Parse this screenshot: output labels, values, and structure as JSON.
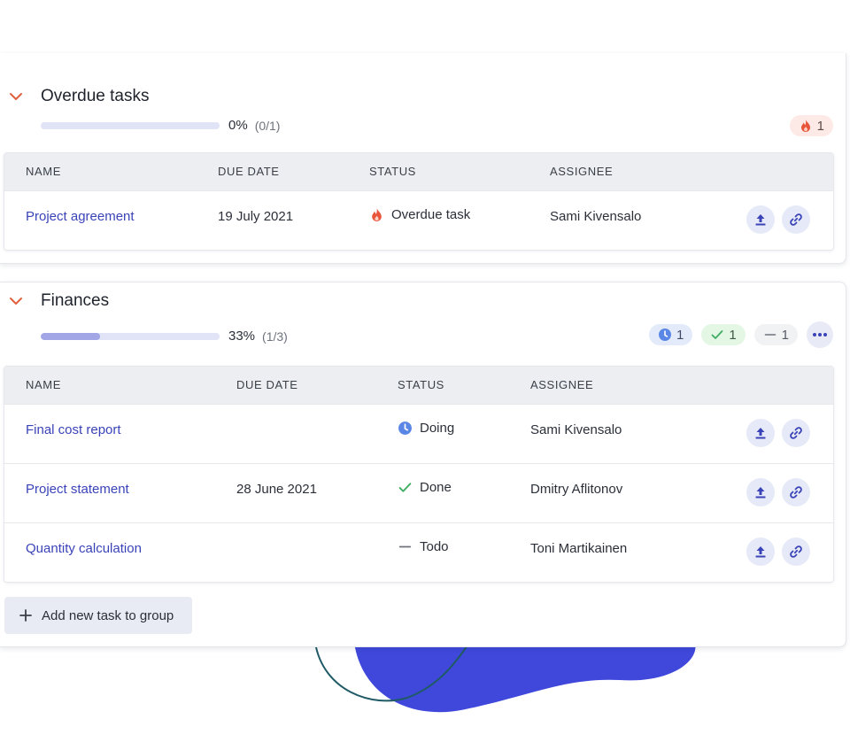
{
  "colors": {
    "accent_link": "#3a43b7",
    "chevron_orange": "#e0603e",
    "blob_blue": "#3f48db",
    "progress_track": "#e1e3f6",
    "progress_fill": "#a2a6e6"
  },
  "groups": [
    {
      "title": "Overdue tasks",
      "progress": {
        "percent_label": "0%",
        "count_label": "(0/1)",
        "fraction": 0.0
      },
      "badges": [
        {
          "icon": "fire-icon",
          "count": "1"
        }
      ],
      "columns": [
        "NAME",
        "DUE DATE",
        "STATUS",
        "ASSIGNEE"
      ],
      "rows": [
        {
          "name": "Project agreement",
          "due": "19 July 2021",
          "status": "Overdue task",
          "status_icon": "fire-icon",
          "assignee": "Sami Kivensalo"
        }
      ]
    },
    {
      "title": "Finances",
      "progress": {
        "percent_label": "33%",
        "count_label": "(1/3)",
        "fraction": 0.33
      },
      "badges": [
        {
          "icon": "clock-icon",
          "count": "1"
        },
        {
          "icon": "check-icon",
          "count": "1"
        },
        {
          "icon": "dash-icon",
          "count": "1"
        }
      ],
      "more_icon": "more-horizontal-icon",
      "columns": [
        "NAME",
        "DUE DATE",
        "STATUS",
        "ASSIGNEE"
      ],
      "rows": [
        {
          "name": "Final cost report",
          "due": "",
          "status": "Doing",
          "status_icon": "clock-icon",
          "assignee": "Sami Kivensalo"
        },
        {
          "name": "Project statement",
          "due": "28 June 2021",
          "status": "Done",
          "status_icon": "check-icon",
          "assignee": "Dmitry Aflitonov"
        },
        {
          "name": "Quantity calculation",
          "due": "",
          "status": "Todo",
          "status_icon": "dash-icon",
          "assignee": "Toni Martikainen"
        }
      ]
    }
  ],
  "row_action_icons": [
    "upload-icon",
    "link-icon"
  ],
  "add_task_label": "Add new task to group"
}
